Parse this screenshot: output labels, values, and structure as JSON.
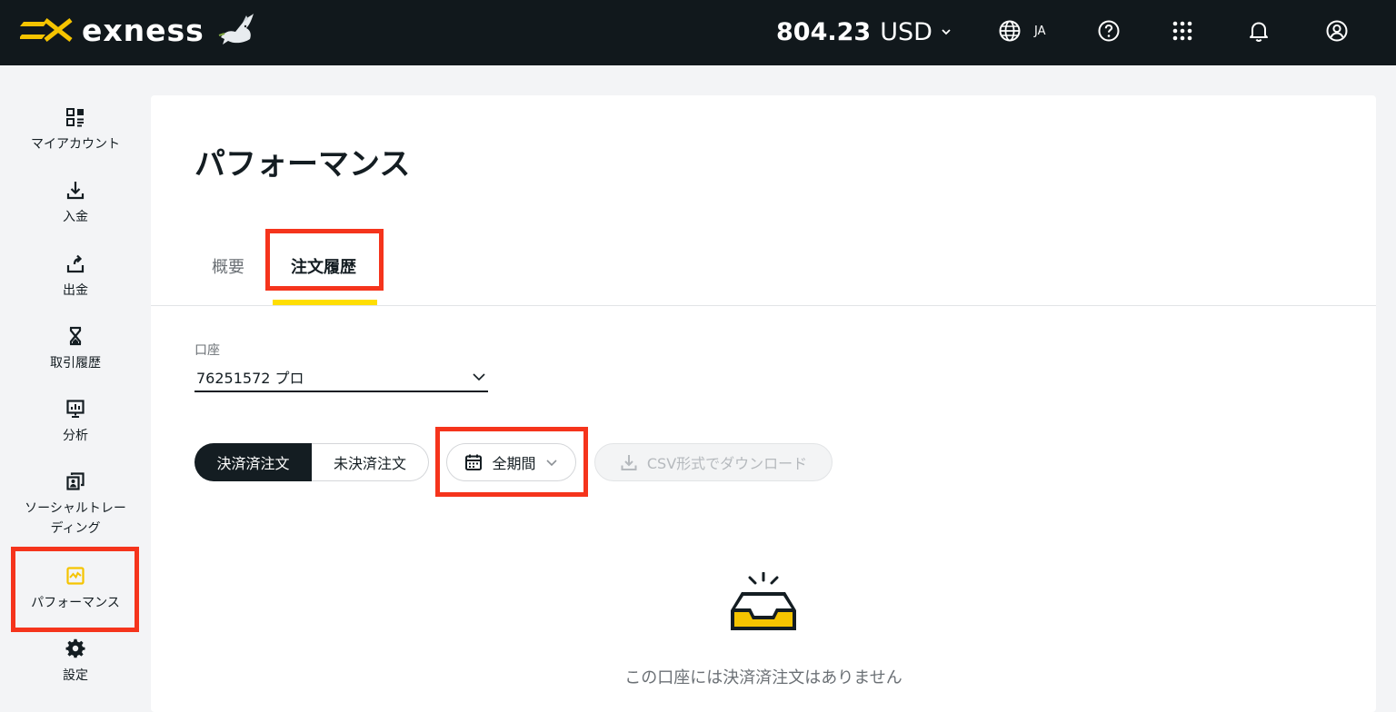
{
  "header": {
    "brand": "exness",
    "balance_amount": "804.23",
    "balance_currency": "USD",
    "language": "JA",
    "icons": [
      "globe-icon",
      "help-icon",
      "apps-grid-icon",
      "bell-icon",
      "user-icon"
    ]
  },
  "sidebar": {
    "items": [
      {
        "label": "マイアカウント",
        "icon": "dashboard-icon"
      },
      {
        "label": "入金",
        "icon": "deposit-icon"
      },
      {
        "label": "出金",
        "icon": "withdraw-icon"
      },
      {
        "label": "取引履歴",
        "icon": "hourglass-icon"
      },
      {
        "label": "分析",
        "icon": "analytics-icon"
      },
      {
        "label": "ソーシャルトレーディング",
        "icon": "social-trading-icon"
      },
      {
        "label": "パフォーマンス",
        "icon": "performance-icon",
        "active": true
      },
      {
        "label": "設定",
        "icon": "gear-icon"
      }
    ]
  },
  "main": {
    "title": "パフォーマンス",
    "tabs": [
      {
        "label": "概要"
      },
      {
        "label": "注文履歴",
        "active": true
      }
    ],
    "account": {
      "label": "口座",
      "value": "76251572 プロ"
    },
    "order_filter": {
      "closed": "決済済注文",
      "open": "未決済注文"
    },
    "period": {
      "label": "全期間"
    },
    "csv": {
      "label": "CSV形式でダウンロード"
    },
    "empty_state": {
      "message": "この口座には決済済注文はありません"
    }
  },
  "colors": {
    "header_bg": "#11181c",
    "accent_yellow": "#ffde02",
    "highlight_red": "#f5341c",
    "text_dark": "#141d22"
  }
}
